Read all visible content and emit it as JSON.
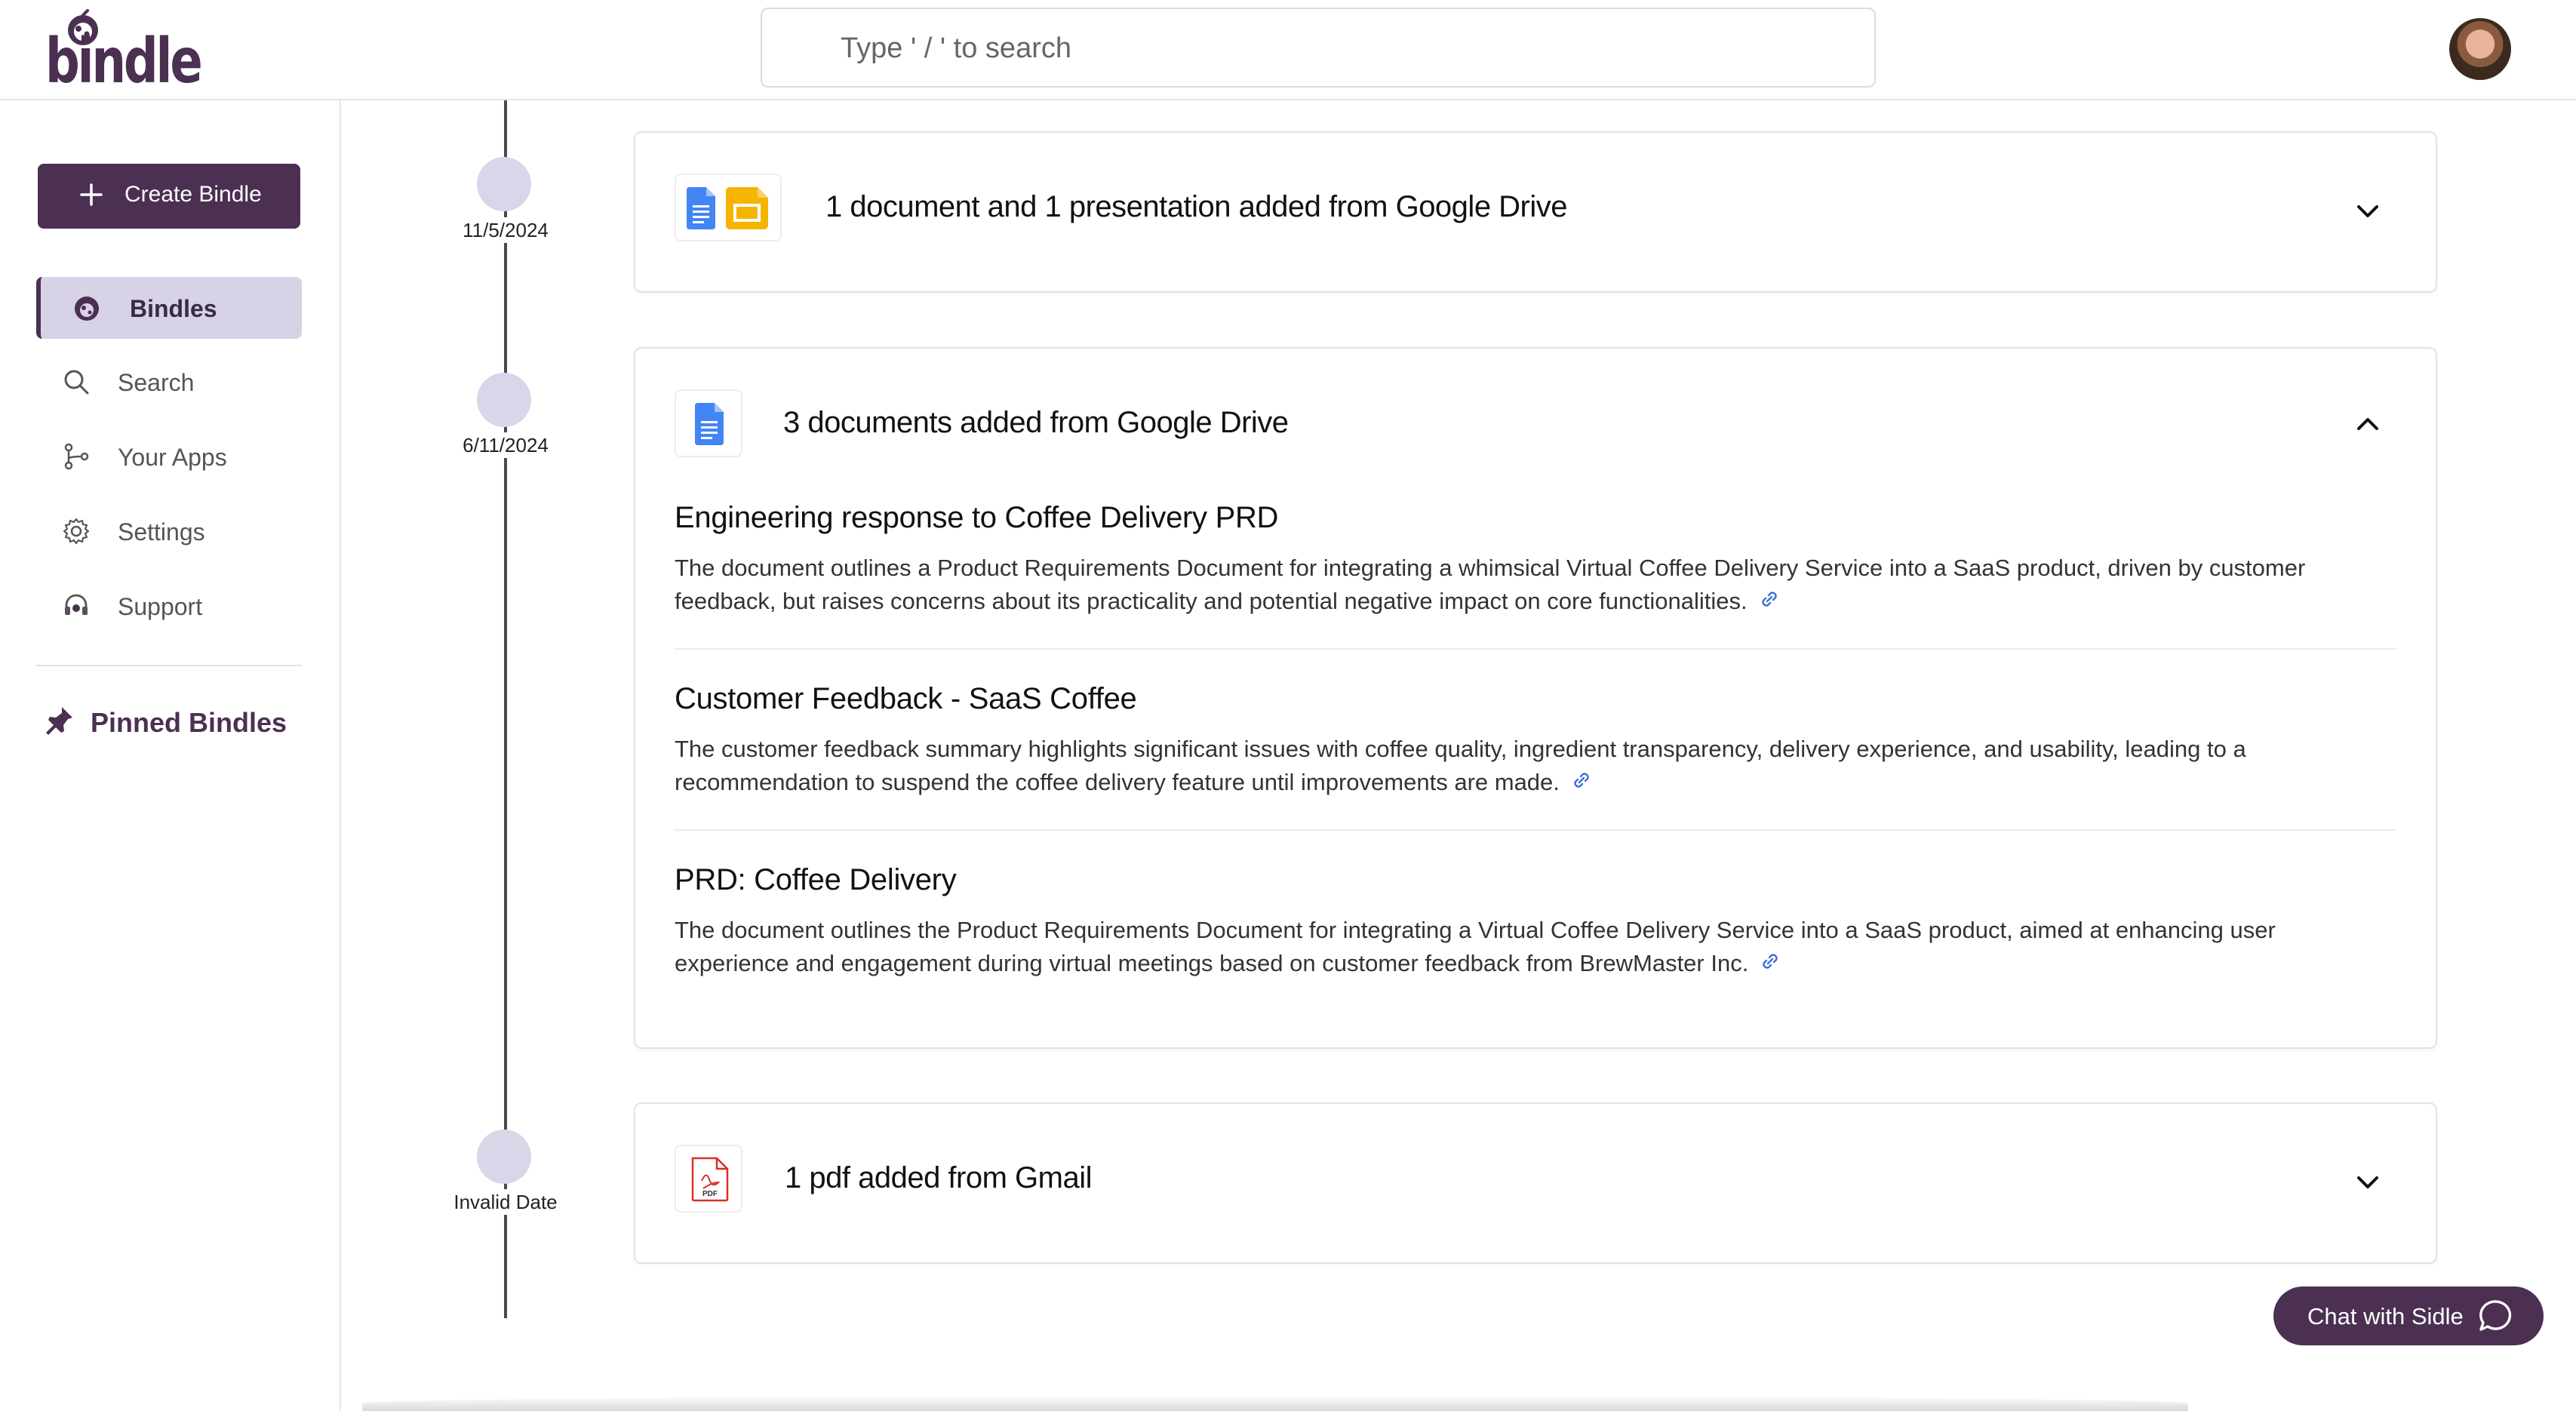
{
  "app": {
    "logo_text": "bindle",
    "search_placeholder": "Type ' / ' to search",
    "avatar_name": "user-avatar"
  },
  "sidebar": {
    "create_label": "Create Bindle",
    "items": [
      {
        "label": "Bindles",
        "icon": "bindle-icon",
        "active": true
      },
      {
        "label": "Search",
        "icon": "search-icon",
        "active": false
      },
      {
        "label": "Your Apps",
        "icon": "apps-branch-icon",
        "active": false
      },
      {
        "label": "Settings",
        "icon": "gear-icon",
        "active": false
      },
      {
        "label": "Support",
        "icon": "headset-icon",
        "active": false
      }
    ],
    "pinned_label": "Pinned Bindles"
  },
  "timeline": [
    {
      "date": "11/5/2024"
    },
    {
      "date": "6/11/2024"
    },
    {
      "date": "Invalid Date"
    }
  ],
  "cards": [
    {
      "title": "1 document and 1 presentation added from Google Drive",
      "expanded": false
    },
    {
      "title": "3 documents added from Google Drive",
      "expanded": true,
      "documents": [
        {
          "title": "Engineering response to Coffee Delivery PRD",
          "description": "The document outlines a Product Requirements Document for integrating a whimsical Virtual Coffee Delivery Service into a SaaS product, driven by customer feedback, but raises concerns about its practicality and potential negative impact on core functionalities."
        },
        {
          "title": "Customer Feedback - SaaS Coffee",
          "description": "The customer feedback summary highlights significant issues with coffee quality, ingredient transparency, delivery experience, and usability, leading to a recommendation to suspend the coffee delivery feature until improvements are made."
        },
        {
          "title": "PRD: Coffee Delivery",
          "description": "The document outlines the Product Requirements Document for integrating a Virtual Coffee Delivery Service into a SaaS product, aimed at enhancing user experience and engagement during virtual meetings based on customer feedback from BrewMaster Inc."
        }
      ]
    },
    {
      "title": "1 pdf added from Gmail",
      "expanded": false,
      "pdf_label": "PDF"
    }
  ],
  "chat": {
    "label": "Chat with Sidle"
  },
  "colors": {
    "brand": "#4b3052",
    "active_nav": "#d8d2e7",
    "timeline_dot": "#dad6ea",
    "gdoc_blue": "#4285f4",
    "gslide_yellow": "#f4b400",
    "pdf_red": "#d93025"
  }
}
